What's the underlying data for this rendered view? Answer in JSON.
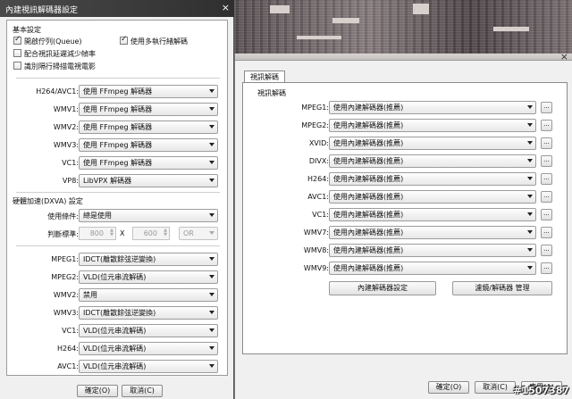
{
  "left_window": {
    "title": "內建視訊解碼器設定",
    "close_glyph": "×",
    "basic": {
      "title": "基本設定",
      "checkboxes": [
        {
          "label": "開啟佇列(Queue)",
          "checked": true
        },
        {
          "label": "使用多執行緒解碼",
          "checked": true
        },
        {
          "label": "配合視訊延遲減少幀率",
          "checked": false
        },
        {
          "label": "識別隔行掃描電視電影",
          "checked": false
        }
      ]
    },
    "decoders": [
      {
        "label": "H264/AVC1:",
        "value": "使用 FFmpeg 解碼器"
      },
      {
        "label": "WMV1:",
        "value": "使用 FFmpeg 解碼器"
      },
      {
        "label": "WMV2:",
        "value": "使用 FFmpeg 解碼器"
      },
      {
        "label": "WMV3:",
        "value": "使用 FFmpeg 解碼器"
      },
      {
        "label": "VC1:",
        "value": "使用 FFmpeg 解碼器"
      },
      {
        "label": "VP8:",
        "value": "LibVPX 解碼器"
      }
    ],
    "dxva": {
      "title": "硬體加速(DXVA) 設定",
      "use_label": "使用條件:",
      "use_value": "總是使用",
      "judge_label": "判斷標準:",
      "width": "800",
      "x_label": "X",
      "height": "600",
      "mode": "OR"
    },
    "dxva_decoders": [
      {
        "label": "MPEG1:",
        "value": "IDCT(離散餘弦逆變換)"
      },
      {
        "label": "MPEG2:",
        "value": "VLD(位元串流解碼)"
      },
      {
        "label": "WMV2:",
        "value": "禁用"
      },
      {
        "label": "WMV3:",
        "value": "IDCT(離散餘弦逆變換)"
      },
      {
        "label": "VC1:",
        "value": "VLD(位元串流解碼)"
      },
      {
        "label": "H264:",
        "value": "VLD(位元串流解碼)"
      },
      {
        "label": "AVC1:",
        "value": "VLD(位元串流解碼)"
      }
    ],
    "ok_label": "確定(O)",
    "cancel_label": "取消(C)"
  },
  "right_window": {
    "close_glyph": "×",
    "tab_label": "視訊解碼",
    "group_title": "視訊解碼",
    "codecs": [
      {
        "label": "MPEG1:",
        "value": "使用內建解碼器(推薦)"
      },
      {
        "label": "MPEG2:",
        "value": "使用內建解碼器(推薦)"
      },
      {
        "label": "XVID:",
        "value": "使用內建解碼器(推薦)"
      },
      {
        "label": "DIVX:",
        "value": "使用內建解碼器(推薦)"
      },
      {
        "label": "H264:",
        "value": "使用內建解碼器(推薦)"
      },
      {
        "label": "AVC1:",
        "value": "使用內建解碼器(推薦)"
      },
      {
        "label": "VC1:",
        "value": "使用內建解碼器(推薦)"
      },
      {
        "label": "WMV7:",
        "value": "使用內建解碼器(推薦)"
      },
      {
        "label": "WMV8:",
        "value": "使用內建解碼器(推薦)"
      },
      {
        "label": "WMV9:",
        "value": "使用內建解碼器(推薦)"
      }
    ],
    "more_glyph": "...",
    "builtin_settings_label": "內建解碼器設定",
    "filter_manage_label": "濾鏡/解碼器 管理",
    "ok_label": "確定(O)",
    "cancel_label": "取消(C)",
    "apply_label": "應用(A)"
  },
  "watermark": "#1507387"
}
